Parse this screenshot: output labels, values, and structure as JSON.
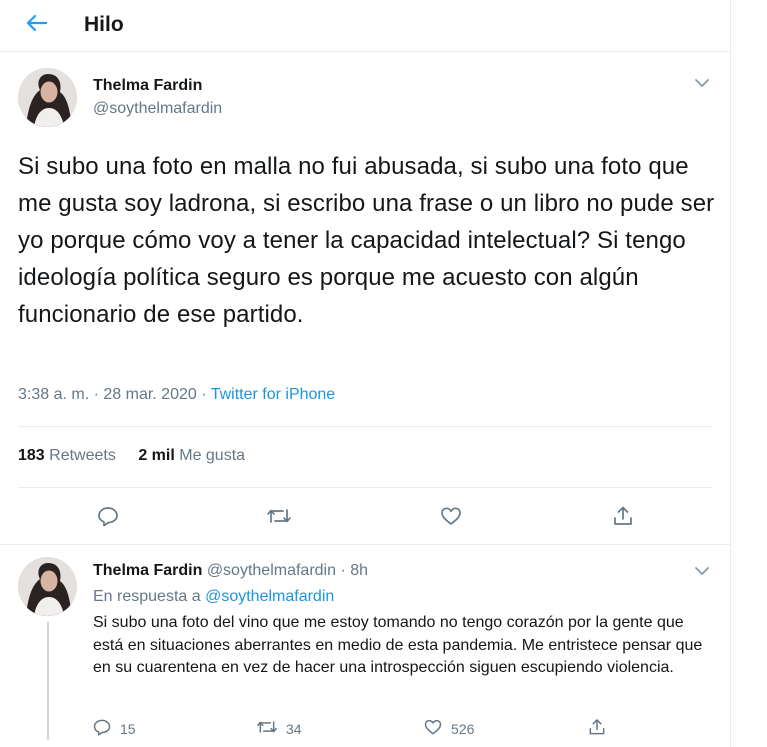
{
  "header": {
    "title": "Hilo",
    "back_icon": "arrow-left-icon"
  },
  "main_tweet": {
    "name": "Thelma Fardin",
    "handle": "@soythelmafardin",
    "text": "Si subo una foto en malla no fui abusada, si subo una foto que me gusta soy ladrona, si escribo una frase o un libro no pude ser yo porque cómo voy a tener la capacidad intelectual? Si tengo ideología política seguro es porque me acuesto con algún funcionario de ese partido.",
    "time": "3:38 a. m. · 28 mar. 2020 · ",
    "source": "Twitter for iPhone",
    "retweets_count": "183",
    "retweets_label": "Retweets",
    "likes_count": "2 mil",
    "likes_label": "Me gusta",
    "actions": [
      "reply-icon",
      "retweet-icon",
      "like-icon",
      "share-icon"
    ]
  },
  "reply_tweet": {
    "name": "Thelma Fardin",
    "handle_time": "@soythelmafardin · 8h",
    "reply_prefix": "En respuesta a ",
    "reply_mention": "@soythelmafardin",
    "text": "Si subo una foto del vino que me estoy tomando no tengo corazón por la gente que está en situaciones aberrantes en medio de esta pandemia. Me entristece pensar que en su cuarentena en vez de hacer una introspección siguen escupiendo violencia.",
    "reply_count": "15",
    "retweet_count": "34",
    "like_count": "526"
  },
  "colors": {
    "accent": "#1b95e0",
    "secondary_text": "#657786",
    "divider": "#e6ecf0"
  }
}
